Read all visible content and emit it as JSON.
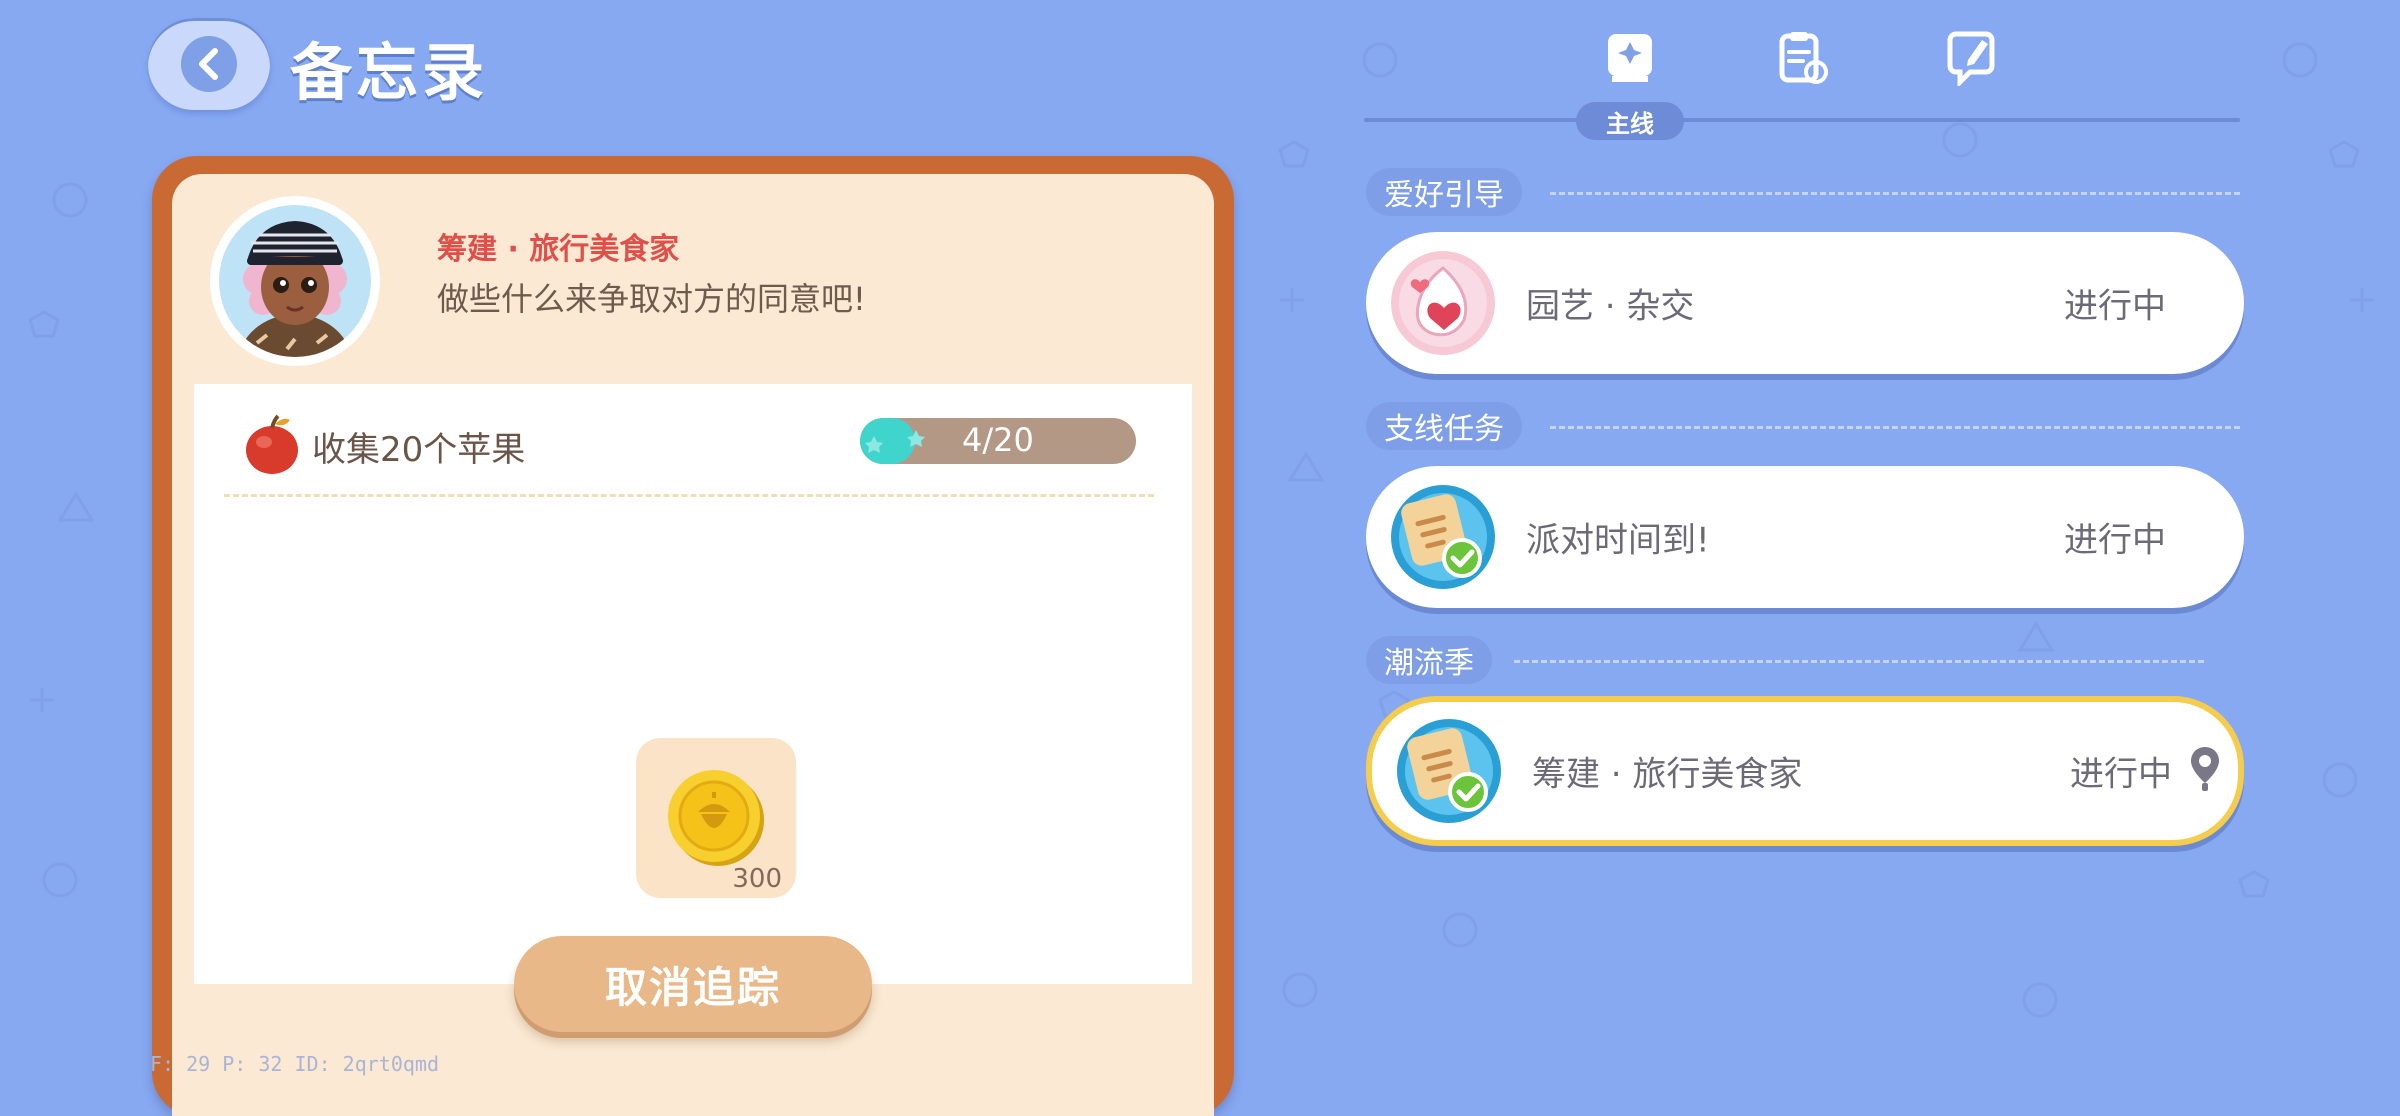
{
  "header": {
    "title": "备忘录"
  },
  "npc": {
    "name": "筹建 · 旅行美食家",
    "message": "做些什么来争取对方的同意吧!"
  },
  "task": {
    "name": "收集20个苹果",
    "progress_text": "4/20",
    "progress": 0.2
  },
  "reward": {
    "quantity": "300"
  },
  "cancel_label": "取消追踪",
  "debug": {
    "text": "F: 29   P: 32   ID: 2qrt0qmd"
  },
  "tabs": {
    "active_label": "主线",
    "icons": [
      "sparkle-book-icon",
      "clipboard-refresh-icon",
      "pencil-note-icon"
    ]
  },
  "sections": [
    {
      "title": "爱好引导",
      "quests": [
        {
          "name": "园艺 · 杂交",
          "status": "进行中",
          "icon": "heart-egg-icon"
        }
      ]
    },
    {
      "title": "支线任务",
      "quests": [
        {
          "name": "派对时间到!",
          "status": "进行中",
          "icon": "note-check-icon"
        }
      ]
    },
    {
      "title": "潮流季",
      "quests": [
        {
          "name": "筹建 · 旅行美食家",
          "status": "进行中",
          "icon": "note-check-icon",
          "tracked": true
        }
      ]
    }
  ],
  "colors": {
    "background": "#86a9f2",
    "card_border": "#c96a35",
    "progress_fill": "#3fd4cc",
    "active_outline": "#f4cd4f",
    "npc_name": "#e0504a"
  }
}
